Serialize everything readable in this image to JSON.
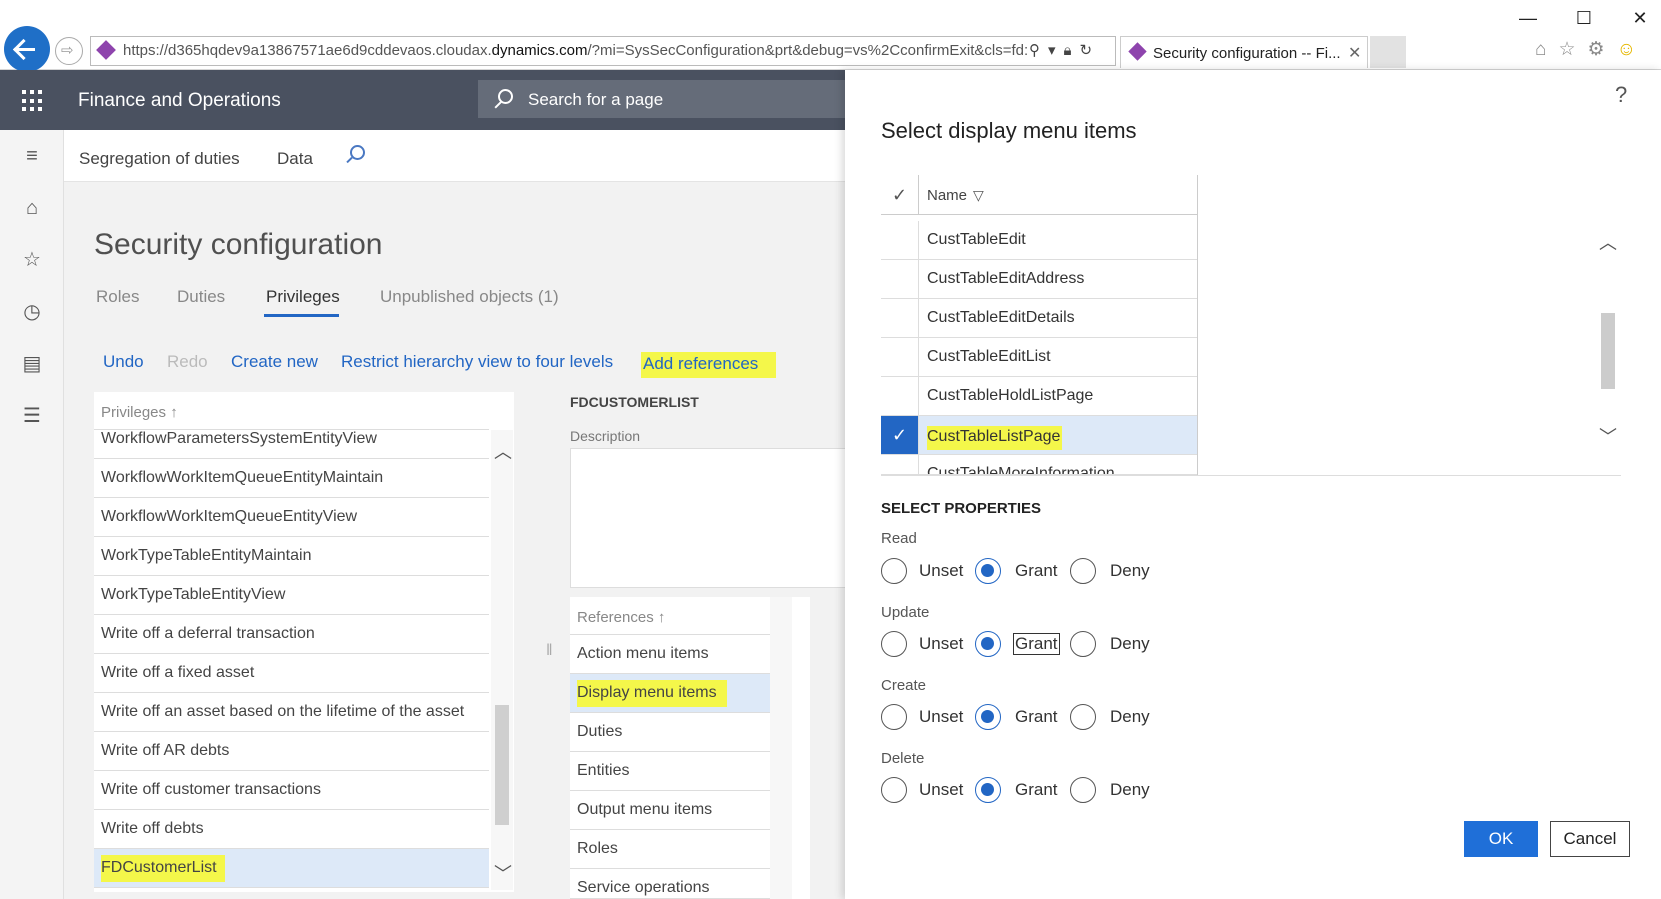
{
  "browser": {
    "url_prefix": "https://d365hqdev9a13867571ae6d9cddevaos.cloudax.",
    "url_domain": "dynamics.com",
    "url_suffix": "/?mi=SysSecConfiguration&prt&debug=vs%2CconfirmExit&cls=fd:",
    "tab_title": "Security configuration -- Fi...",
    "tab_close": "✕",
    "win_minimize": "—",
    "win_maximize": "☐",
    "win_close": "✕"
  },
  "app": {
    "title": "Finance and Operations",
    "search_placeholder": "Search for a page"
  },
  "topnav": {
    "item1": "Segregation of duties",
    "item2": "Data"
  },
  "page": {
    "title": "Security configuration",
    "tabs": [
      "Roles",
      "Duties",
      "Privileges",
      "Unpublished objects (1)"
    ],
    "actions": {
      "undo": "Undo",
      "redo": "Redo",
      "create_new": "Create new",
      "restrict": "Restrict hierarchy view to four levels",
      "add_references": "Add references"
    }
  },
  "privileges": {
    "header": "Privileges ↑",
    "items": [
      "WorkflowParametersSystemEntityView",
      "WorkflowWorkItemQueueEntityMaintain",
      "WorkflowWorkItemQueueEntityView",
      "WorkTypeTableEntityMaintain",
      "WorkTypeTableEntityView",
      "Write off a deferral transaction",
      "Write off a fixed asset",
      "Write off an asset based on the lifetime of the asset",
      "Write off AR debts",
      "Write off customer transactions",
      "Write off debts",
      "FDCustomerList"
    ],
    "selected": "FDCustomerList"
  },
  "detail": {
    "name": "FDCUSTOMERLIST",
    "description_label": "Description"
  },
  "references": {
    "header": "References ↑",
    "items": [
      "Action menu items",
      "Display menu items",
      "Duties",
      "Entities",
      "Output menu items",
      "Roles",
      "Service operations"
    ]
  },
  "dialog": {
    "title": "Select display menu items",
    "help": "?",
    "grid_header_name": "Name",
    "grid_rows": [
      "CustTableEdit",
      "CustTableEditAddress",
      "CustTableEditDetails",
      "CustTableEditList",
      "CustTableHoldListPage",
      "CustTableListPage",
      "CustTableMoreInformation"
    ],
    "selected_row": "CustTableListPage",
    "properties_title": "SELECT PROPERTIES",
    "properties": [
      {
        "label": "Read",
        "value": "Grant"
      },
      {
        "label": "Update",
        "value": "Grant"
      },
      {
        "label": "Create",
        "value": "Grant"
      },
      {
        "label": "Delete",
        "value": "Grant"
      }
    ],
    "options": {
      "unset": "Unset",
      "grant": "Grant",
      "deny": "Deny"
    },
    "ok": "OK",
    "cancel": "Cancel"
  },
  "colors": {
    "accent": "#2266c4",
    "appbar": "#4a5160",
    "highlight": "#f4f74a",
    "selection": "#dde9f8"
  },
  "icons": {
    "back": "back-arrow-icon",
    "forward": "forward-arrow-icon",
    "waffle": "app-launcher-icon",
    "search": "search-icon",
    "home": "home-icon",
    "favorites": "star-icon",
    "recent": "clock-icon",
    "workspaces": "workspace-icon",
    "modules": "list-icon",
    "filter": "filter-icon",
    "check": "checkmark-icon",
    "help": "help-icon"
  }
}
